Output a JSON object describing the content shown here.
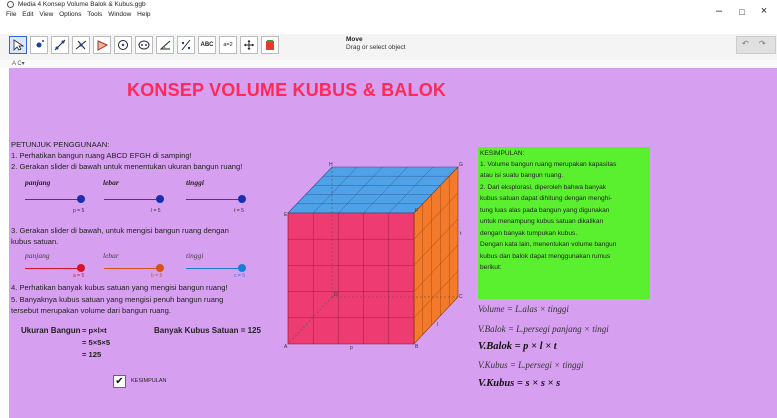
{
  "window": {
    "title": "Media 4 Konsep Volume Balok & Kubus.ggb",
    "menus": [
      "File",
      "Edit",
      "View",
      "Options",
      "Tools",
      "Window",
      "Help"
    ],
    "controls": [
      "–",
      "□",
      "×"
    ]
  },
  "toolbar": {
    "active_tool_title": "Move",
    "active_tool_desc": "Drag or select object",
    "tools": [
      "move-icon",
      "point-icon",
      "line-icon",
      "perpendicular-icon",
      "polygon-icon",
      "circle-icon",
      "ellipse-icon",
      "angle-icon",
      "reflect-icon",
      "text-tool-icon",
      "slider-icon",
      "move-view-icon",
      "color-icon"
    ],
    "text_tool_label": "ABC",
    "slider_tool_label": "a=2",
    "undo_label": "↶",
    "redo_label": "↷"
  },
  "stylebar": {
    "label": "A C▾"
  },
  "main": {
    "title": "KONSEP VOLUME KUBUS & BALOK",
    "instructions_heading": "PETUNJUK PENGGUNAAN:",
    "steps": [
      "1. Perhatikan bangun ruang ABCD EFGH di samping!",
      "2. Gerakan slider di bawah untuk menentukan ukuran bangun ruang!",
      "3. Gerakan slider di bawah, untuk mengisi bangun ruang dengan",
      "    kubus satuan.",
      "4. Perhatikan banyak kubus satuan yang mengisi bangun ruang!",
      "5. Banyaknya kubus satuan yang mengisi penuh bangun ruang",
      "    tersebut merupakan volume dari bangun ruang."
    ],
    "sliders_a": [
      {
        "label": "panjang",
        "value_text": "p = 5",
        "value": 5,
        "color": "#1a2fb0"
      },
      {
        "label": "lebar",
        "value_text": "l = 5",
        "value": 5,
        "color": "#1a2fb0"
      },
      {
        "label": "tinggi",
        "value_text": "t = 5",
        "value": 5,
        "color": "#1a2fb0"
      }
    ],
    "sliders_b": [
      {
        "label": "panjang",
        "value_text": "a = 5",
        "color": "#d4142a"
      },
      {
        "label": "lebar",
        "value_text": "b = 5",
        "color": "#d4541a"
      },
      {
        "label": "tinggi",
        "value_text": "c = 5",
        "color": "#1a7fd4"
      }
    ],
    "ukuran_label": "Ukuran Bangun",
    "ukuran_lines": [
      "= p×l×t",
      "= 5×5×5",
      "= 125"
    ],
    "banyak_label": "Banyak Kubus Satuan = 125",
    "checkbox_label": "KESIMPULAN",
    "checkbox_checked": true
  },
  "cube": {
    "vertex_labels": {
      "E": "E",
      "H": "H",
      "G": "G",
      "F": "F",
      "A": "A",
      "B": "B",
      "C": "C",
      "D": "D"
    },
    "edge_labels": {
      "p": "p",
      "l": "l",
      "t": "t"
    },
    "colors": {
      "top": "#4fa2e8",
      "front": "#ee3c72",
      "side": "#f37a2b",
      "grid": "#7a1a3a"
    }
  },
  "conclusion": {
    "heading": "KESIMPULAN:",
    "lines": [
      "1. Volume bangun ruang merupakan kapasitas",
      "    atau isi suatu bangun ruang.",
      "2. Dari eksplorasi, diperoleh bahwa banyak",
      "    kubus satuan dapat dihitung dengan menghi-",
      "    tung luas alas pada bangun yang digunakan",
      "    untuk menampung kubus satuan dikalikan",
      "    dengan banyak tumpukan kubus.",
      "    Dengan kata lain, menentukan volume bangun",
      "    kubus dan balok dapat menggunakan rumus",
      "    berikut:"
    ]
  },
  "formulas": [
    {
      "text": "Volume = L.alas × tinggi",
      "bold": false
    },
    {
      "text": "V.Balok = L.persegi panjang × tingi",
      "bold": false
    },
    {
      "text": "V.Balok = p × l × t",
      "bold": true
    },
    {
      "text": "V.Kubus = L.persegi × tinggi",
      "bold": false
    },
    {
      "text": "V.Kubus = s × s × s",
      "bold": true
    }
  ]
}
